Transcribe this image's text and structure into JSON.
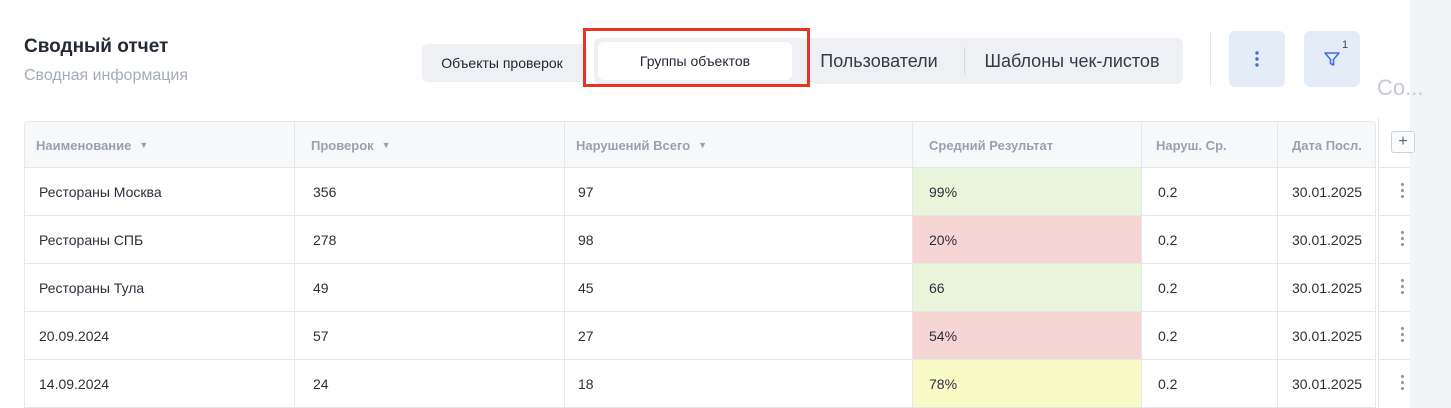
{
  "header": {
    "title": "Сводный отчет",
    "subtitle": "Сводная информация"
  },
  "tabs": [
    {
      "label": "Объекты проверок",
      "active": false
    },
    {
      "label": "Группы объектов",
      "active": true
    },
    {
      "label": "Пользователи",
      "active": false
    },
    {
      "label": "Шаблоны чек-листов",
      "active": false
    }
  ],
  "toolbar": {
    "more_icon": "vertical-dots-icon",
    "filter_icon": "filter-funnel-icon",
    "filter_count": "1"
  },
  "columns_panel_label": "Co...",
  "table": {
    "columns": [
      {
        "label": "Наименование",
        "sortable": true
      },
      {
        "label": "Проверок",
        "sortable": true
      },
      {
        "label": "Нарушений Всего",
        "sortable": true
      },
      {
        "label": "Средний Результат",
        "sortable": false
      },
      {
        "label": "Наруш. Ср.",
        "sortable": false
      },
      {
        "label": "Дата Посл.",
        "sortable": false
      }
    ],
    "rows": [
      {
        "name": "Рестораны Москва",
        "checks": "356",
        "violations": "97",
        "avg_result": "99%",
        "avg_status": "good",
        "viol_avg": "0.2",
        "last_date": "30.01.2025"
      },
      {
        "name": "Рестораны СПБ",
        "checks": "278",
        "violations": "98",
        "avg_result": "20%",
        "avg_status": "bad",
        "viol_avg": "0.2",
        "last_date": "30.01.2025"
      },
      {
        "name": "Рестораны Тула",
        "checks": "49",
        "violations": "45",
        "avg_result": "66",
        "avg_status": "good",
        "viol_avg": "0.2",
        "last_date": "30.01.2025"
      },
      {
        "name": "20.09.2024",
        "checks": "57",
        "violations": "27",
        "avg_result": "54%",
        "avg_status": "bad",
        "viol_avg": "0.2",
        "last_date": "30.01.2025"
      },
      {
        "name": "14.09.2024",
        "checks": "24",
        "violations": "18",
        "avg_result": "78%",
        "avg_status": "medium",
        "viol_avg": "0.2",
        "last_date": "30.01.2025"
      }
    ],
    "status_colors": {
      "good": "#e9f6d9",
      "bad": "#f7d5d5",
      "medium": "#f9fbc6"
    },
    "add_column_icon": "plus-icon",
    "row_menu_icon": "vertical-dots-icon"
  },
  "colors": {
    "accent_highlight": "#ea3323",
    "icon_button_bg": "#e4ecf7"
  }
}
